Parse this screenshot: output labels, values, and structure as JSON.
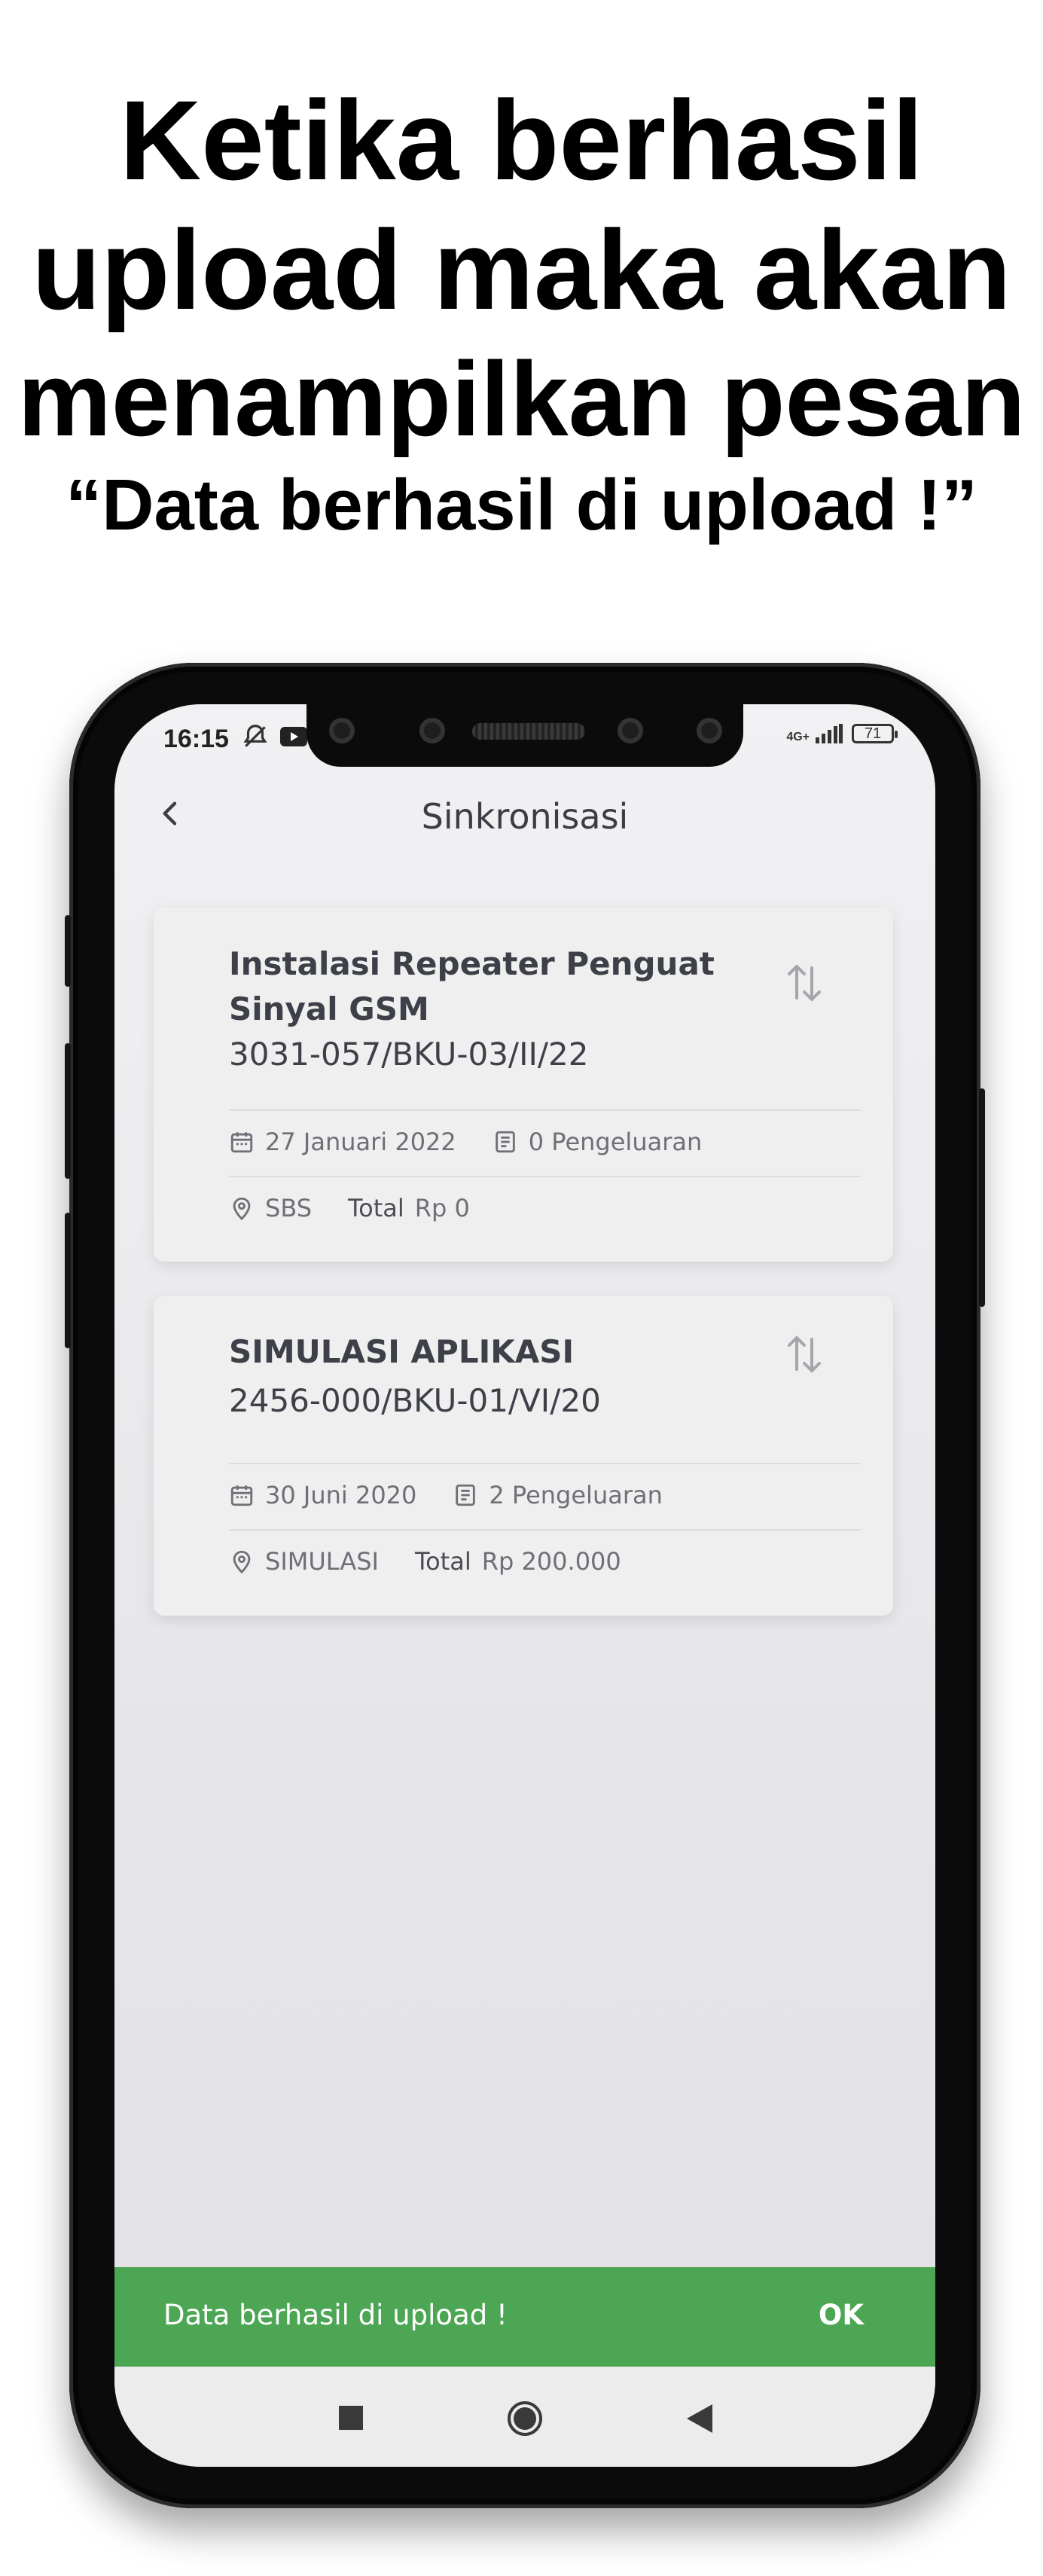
{
  "headline": {
    "line1": "Ketika berhasil",
    "line2": "upload maka akan",
    "line3": "menampilkan pesan",
    "line4": "“Data berhasil di upload !”"
  },
  "status_bar": {
    "time": "16:15",
    "network": "4G+",
    "battery": "71"
  },
  "app_bar": {
    "title": "Sinkronisasi",
    "back_icon": "chevron-left-icon"
  },
  "cards": [
    {
      "title": "Instalasi Repeater Penguat Sinyal GSM",
      "code": "3031-057/BKU-03/II/22",
      "date": "27 Januari 2022",
      "expenses": "0 Pengeluaran",
      "location": "SBS",
      "total_label": "Total",
      "total_value": "Rp 0"
    },
    {
      "title": "SIMULASI APLIKASI",
      "code": "2456-000/BKU-01/VI/20",
      "date": "30 Juni 2020",
      "expenses": "2 Pengeluaran",
      "location": "SIMULASI",
      "total_label": "Total",
      "total_value": "Rp 200.000"
    }
  ],
  "snackbar": {
    "message": "Data berhasil di upload !",
    "action": "OK",
    "color": "#4ca653"
  }
}
